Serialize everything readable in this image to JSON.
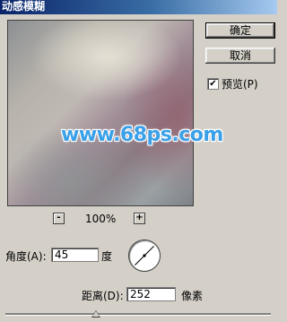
{
  "window": {
    "title": "动感模糊"
  },
  "buttons": {
    "ok": "确定",
    "cancel": "取消"
  },
  "preview_option": {
    "label": "预览(P)",
    "checked": true,
    "check_glyph": "✔"
  },
  "watermark": "www.68ps.com",
  "zoom": {
    "minus": "-",
    "plus": "+",
    "level": "100%"
  },
  "angle": {
    "label": "角度(A):",
    "value": "45",
    "unit": "度",
    "degrees": 45
  },
  "distance": {
    "label": "距离(D):",
    "value": "252",
    "unit": "像素",
    "slider_fraction": 0.34
  },
  "icons": {
    "angle_dial": "angle-dial-icon",
    "slider_thumb": "slider-thumb-icon"
  }
}
